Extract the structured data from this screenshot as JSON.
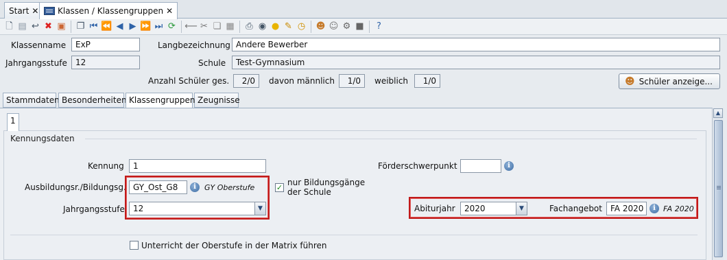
{
  "tabs": [
    {
      "label": "Start",
      "close": "✕"
    },
    {
      "label": "Klassen / Klassengruppen",
      "close": "✕"
    }
  ],
  "toolbar": {
    "icons": [
      "new-icon",
      "save-icon",
      "undo-icon",
      "delete-icon",
      "delete-all-icon",
      "copy-icon",
      "first-icon",
      "prev-page-icon",
      "prev-icon",
      "next-icon",
      "next-page-icon",
      "last-icon",
      "refresh-icon",
      "cut-line-icon",
      "scissors-icon",
      "copy-doc-icon",
      "paste-icon",
      "print-icon",
      "preview-icon",
      "bulb-icon",
      "pen-icon",
      "clock-icon",
      "users-icon",
      "user-icon",
      "settings-icon",
      "stop-icon",
      "help-icon"
    ]
  },
  "header": {
    "klassenname_label": "Klassenname",
    "klassenname_value": "ExP",
    "langbezeichnung_label": "Langbezeichnung",
    "langbezeichnung_value": "Andere Bewerber",
    "jahrgangsstufe_label": "Jahrgangsstufe",
    "jahrgangsstufe_value": "12",
    "schule_label": "Schule",
    "schule_value": "Test-Gymnasium",
    "anzahl_label": "Anzahl Schüler ges.",
    "anzahl_value": "2/0",
    "maennlich_label": "davon männlich",
    "maennlich_value": "1/0",
    "weiblich_label": "weiblich",
    "weiblich_value": "1/0",
    "schueler_button": "Schüler anzeige..."
  },
  "page_tabs": [
    "Stammdaten",
    "Besonderheiten",
    "Klassengruppen",
    "Zeugnisse"
  ],
  "inner_tab": "1",
  "kennung": {
    "group_title": "Kennungsdaten",
    "kennung_label": "Kennung",
    "kennung_value": "1",
    "ausbildung_label": "Ausbildungsr./Bildungsg.",
    "ausbildung_value": "GY_Ost_G8",
    "ausbildung_desc": "GY Oberstufe",
    "nur_bildung_label_1": "nur Bildungsgänge",
    "nur_bildung_label_2": "der Schule",
    "nur_bildung_checked": "✓",
    "jahrgang_label": "Jahrgangsstufe",
    "jahrgang_value": "12",
    "foerder_label": "Förderschwerpunkt",
    "foerder_value": "",
    "abitur_label": "Abiturjahr",
    "abitur_value": "2020",
    "fachangebot_label": "Fachangebot",
    "fachangebot_value": "FA 2020",
    "fachangebot_desc": "FA 2020",
    "matrix_label": "Unterricht der Oberstufe in der Matrix führen"
  },
  "colors": {
    "highlight": "#c11a1a",
    "accent": "#355e9a"
  }
}
